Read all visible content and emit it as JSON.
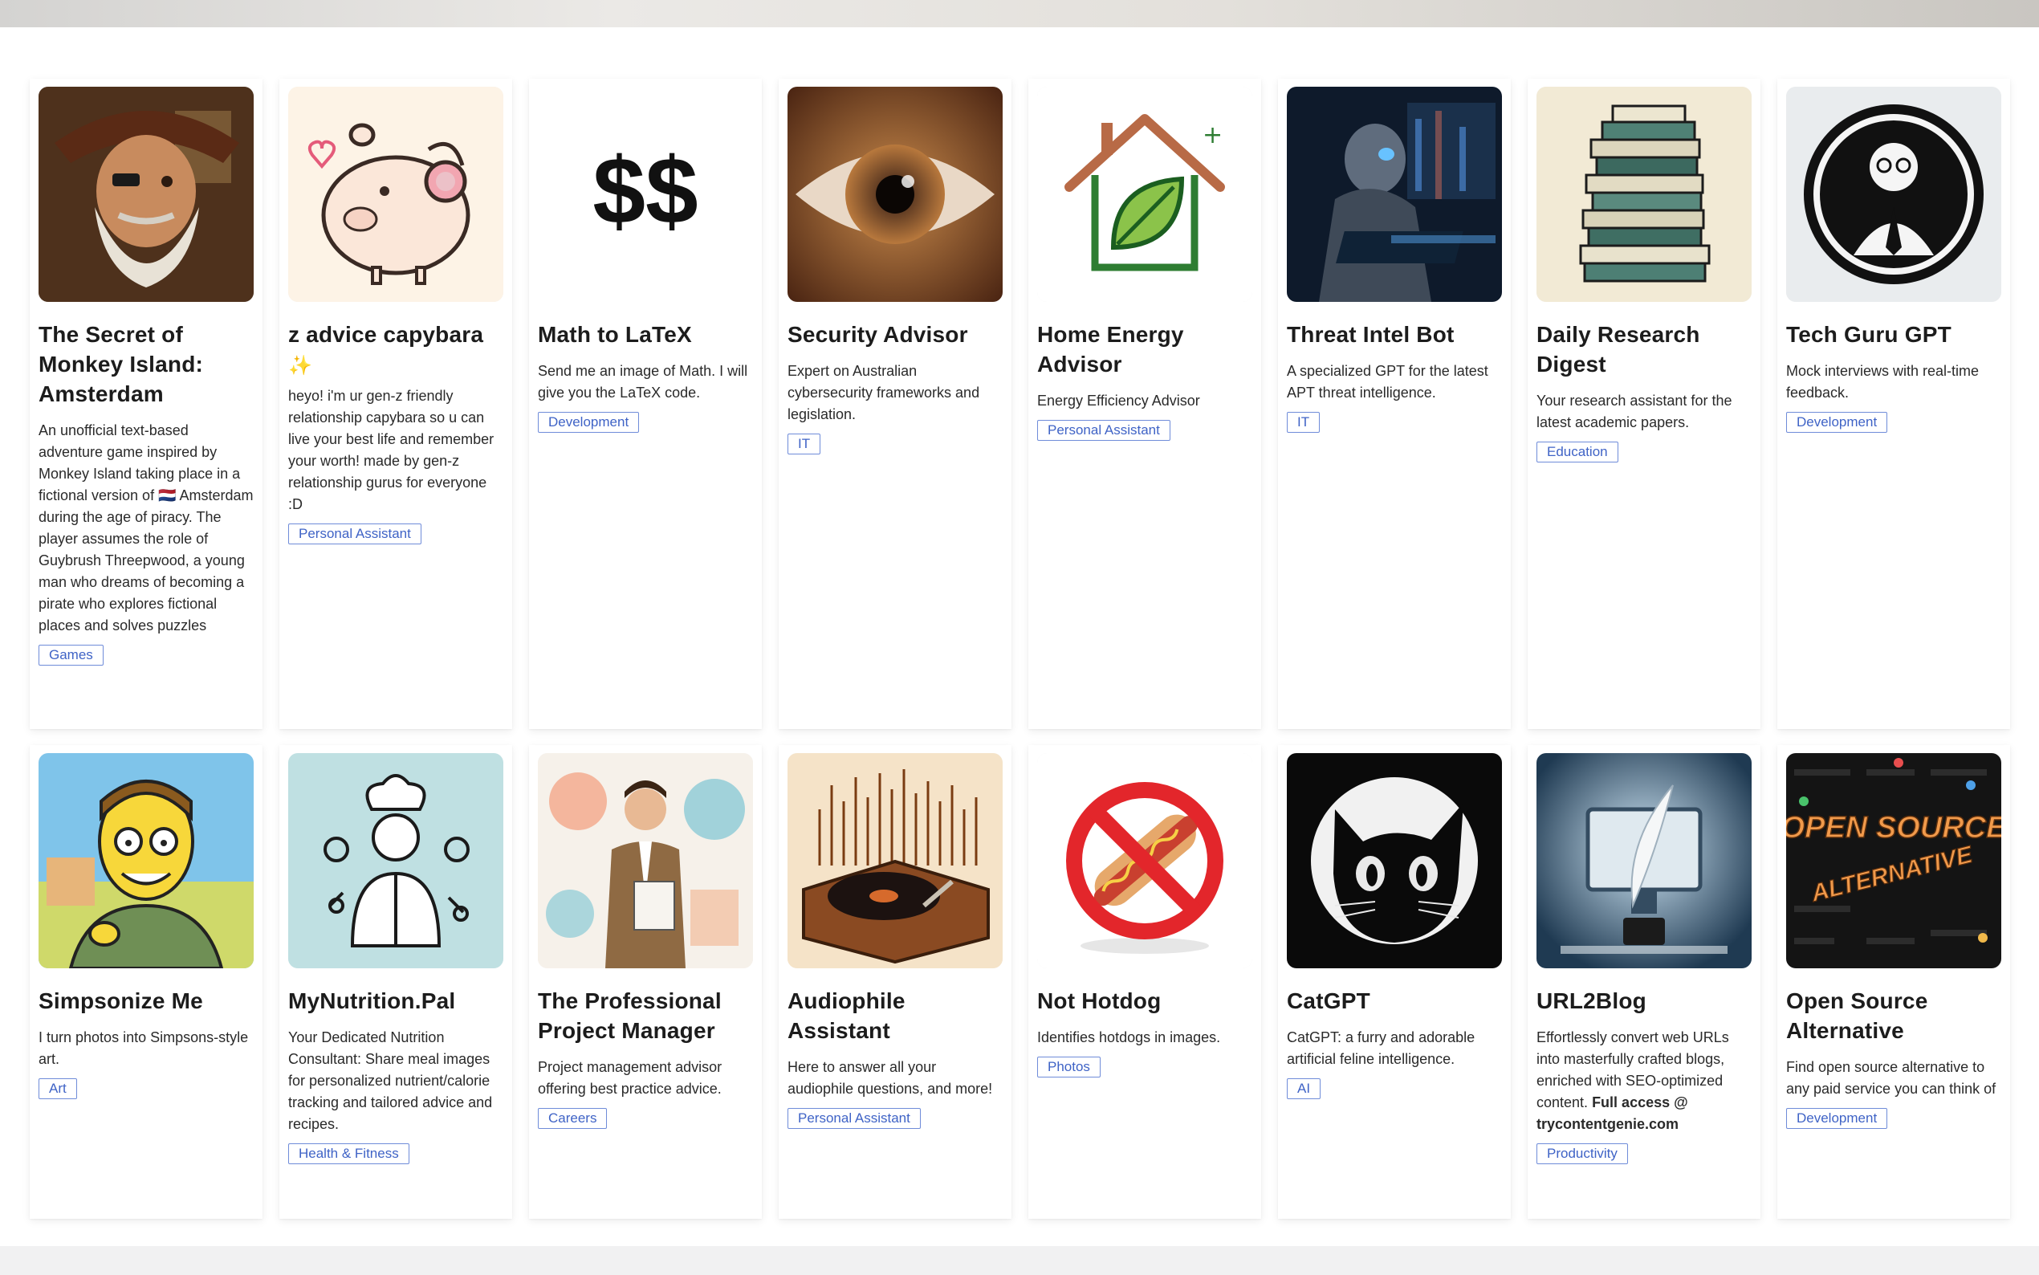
{
  "cards": [
    {
      "title": "The Secret of Monkey Island: Amsterdam",
      "desc": "An unofficial text-based adventure game inspired by Monkey Island taking place in a fictional version of 🇳🇱 Amsterdam during the age of piracy. The player assumes the role of Guybrush Threepwood, a young man who dreams of becoming a pirate who explores fictional places and solves puzzles",
      "tag": "Games",
      "icon": "pirate-portrait-icon"
    },
    {
      "title": "z advice capybara",
      "title_extra": "✨",
      "desc": "heyo! i'm ur gen-z friendly relationship capybara so u can live your best life and remember your worth! made by gen-z relationship gurus for everyone :D",
      "tag": "Personal Assistant",
      "icon": "capybara-headphones-icon"
    },
    {
      "title": "Math to LaTeX",
      "desc": "Send me an image of Math. I will give you the LaTeX code.",
      "tag": "Development",
      "icon": "double-dollar-icon",
      "icon_text": "$$"
    },
    {
      "title": "Security Advisor",
      "desc": "Expert on Australian cybersecurity frameworks and legislation.",
      "tag": "IT",
      "icon": "eye-closeup-icon"
    },
    {
      "title": "Home Energy Advisor",
      "desc": "Energy Efficiency Advisor",
      "tag": "Personal Assistant",
      "icon": "house-leaf-icon"
    },
    {
      "title": "Threat Intel Bot",
      "desc": "A specialized GPT for the latest APT threat intelligence.",
      "tag": "IT",
      "icon": "robot-hacker-icon"
    },
    {
      "title": "Daily Research Digest",
      "desc": "Your research assistant for the latest academic papers.",
      "tag": "Education",
      "icon": "book-stack-icon"
    },
    {
      "title": "Tech Guru GPT",
      "desc": "Mock interviews with real-time feedback.",
      "tag": "Development",
      "icon": "tech-guru-badge-icon"
    },
    {
      "title": "Simpsonize Me",
      "desc": "I turn photos into Simpsons-style art.",
      "tag": "Art",
      "icon": "simpsons-character-icon"
    },
    {
      "title": "MyNutrition.Pal",
      "desc": "Your Dedicated Nutrition Consultant: Share meal images for personalized nutrient/calorie tracking and tailored advice and recipes.",
      "tag": "Health & Fitness",
      "icon": "chef-science-icon"
    },
    {
      "title": "The Professional Project Manager",
      "desc": "Project management advisor offering best practice advice.",
      "tag": "Careers",
      "icon": "business-man-icon"
    },
    {
      "title": "Audiophile Assistant",
      "desc": "Here to answer all your audiophile questions, and more!",
      "tag": "Personal Assistant",
      "icon": "turntable-icon"
    },
    {
      "title": "Not Hotdog",
      "desc": "Identifies hotdogs in images.",
      "tag": "Photos",
      "icon": "no-hotdog-icon"
    },
    {
      "title": "CatGPT",
      "desc": "CatGPT: a furry and adorable artificial feline intelligence.",
      "tag": "AI",
      "icon": "black-cat-icon"
    },
    {
      "title": "URL2Blog",
      "desc": "Effortlessly convert web URLs into masterfully crafted blogs, enriched with SEO-optimized content.",
      "desc_bold": "Full access @ trycontentgenie.com",
      "tag": "Productivity",
      "icon": "quill-monitor-icon"
    },
    {
      "title": "Open Source Alternative",
      "desc": "Find open source alternative to any paid service you can think of",
      "tag": "Development",
      "icon": "open-source-alternative-icon",
      "icon_text_1": "OPEN SOURCE",
      "icon_text_2": "ALTERNATIVE"
    }
  ]
}
